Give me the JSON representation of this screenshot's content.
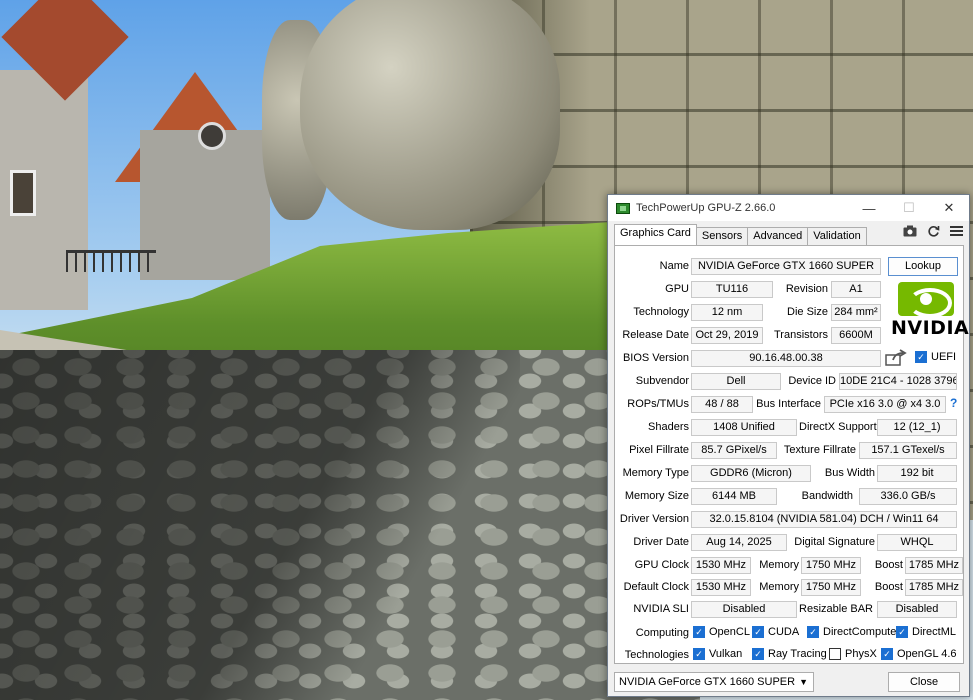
{
  "window": {
    "title": "TechPowerUp GPU-Z 2.66.0",
    "minimize": "—",
    "maximize": "☐",
    "close": "✕"
  },
  "tabs": [
    "Graphics Card",
    "Sensors",
    "Advanced",
    "Validation"
  ],
  "toolbar": {
    "camera_icon": "camera-icon",
    "refresh_icon": "refresh-icon",
    "menu_icon": "menu-icon"
  },
  "fields": {
    "name": {
      "label": "Name",
      "value": "NVIDIA GeForce GTX 1660 SUPER"
    },
    "lookup": "Lookup",
    "gpu": {
      "label": "GPU",
      "value": "TU116"
    },
    "revision": {
      "label": "Revision",
      "value": "A1"
    },
    "technology": {
      "label": "Technology",
      "value": "12 nm"
    },
    "die_size": {
      "label": "Die Size",
      "value": "284 mm²"
    },
    "release_date": {
      "label": "Release Date",
      "value": "Oct 29, 2019"
    },
    "transistors": {
      "label": "Transistors",
      "value": "6600M"
    },
    "bios_version": {
      "label": "BIOS Version",
      "value": "90.16.48.00.38"
    },
    "uefi": "UEFI",
    "subvendor": {
      "label": "Subvendor",
      "value": "Dell"
    },
    "device_id": {
      "label": "Device ID",
      "value": "10DE 21C4 - 1028 3796"
    },
    "rops_tmus": {
      "label": "ROPs/TMUs",
      "value": "48 / 88"
    },
    "bus_interface": {
      "label": "Bus Interface",
      "value": "PCIe x16 3.0 @ x4 3.0"
    },
    "help": "?",
    "shaders": {
      "label": "Shaders",
      "value": "1408 Unified"
    },
    "directx": {
      "label": "DirectX Support",
      "value": "12 (12_1)"
    },
    "pixel_fillrate": {
      "label": "Pixel Fillrate",
      "value": "85.7 GPixel/s"
    },
    "texture_fillrate": {
      "label": "Texture Fillrate",
      "value": "157.1 GTexel/s"
    },
    "memory_type": {
      "label": "Memory Type",
      "value": "GDDR6 (Micron)"
    },
    "bus_width": {
      "label": "Bus Width",
      "value": "192 bit"
    },
    "memory_size": {
      "label": "Memory Size",
      "value": "6144 MB"
    },
    "bandwidth": {
      "label": "Bandwidth",
      "value": "336.0 GB/s"
    },
    "driver_version": {
      "label": "Driver Version",
      "value": "32.0.15.8104 (NVIDIA 581.04) DCH / Win11 64"
    },
    "driver_date": {
      "label": "Driver Date",
      "value": "Aug 14, 2025"
    },
    "digital_signature": {
      "label": "Digital Signature",
      "value": "WHQL"
    },
    "gpu_clock": {
      "label": "GPU Clock",
      "value": "1530 MHz",
      "memory_label": "Memory",
      "memory": "1750 MHz",
      "boost_label": "Boost",
      "boost": "1785 MHz"
    },
    "default_clock": {
      "label": "Default Clock",
      "value": "1530 MHz",
      "memory_label": "Memory",
      "memory": "1750 MHz",
      "boost_label": "Boost",
      "boost": "1785 MHz"
    },
    "nvidia_sli": {
      "label": "NVIDIA SLI",
      "value": "Disabled"
    },
    "resizable_bar": {
      "label": "Resizable BAR",
      "value": "Disabled"
    }
  },
  "logo": {
    "text": "NVIDIA",
    "color": "#76b900"
  },
  "computing": {
    "label": "Computing",
    "items": [
      {
        "name": "OpenCL",
        "checked": true
      },
      {
        "name": "CUDA",
        "checked": true
      },
      {
        "name": "DirectCompute",
        "checked": true
      },
      {
        "name": "DirectML",
        "checked": true
      }
    ]
  },
  "technologies": {
    "label": "Technologies",
    "items": [
      {
        "name": "Vulkan",
        "checked": true
      },
      {
        "name": "Ray Tracing",
        "checked": true
      },
      {
        "name": "PhysX",
        "checked": false
      },
      {
        "name": "OpenGL 4.6",
        "checked": true
      }
    ]
  },
  "footer": {
    "selected_gpu": "NVIDIA GeForce GTX 1660 SUPER",
    "close": "Close"
  },
  "colors": {
    "accent": "#1b6fd2",
    "nvidia_green": "#76b900"
  }
}
